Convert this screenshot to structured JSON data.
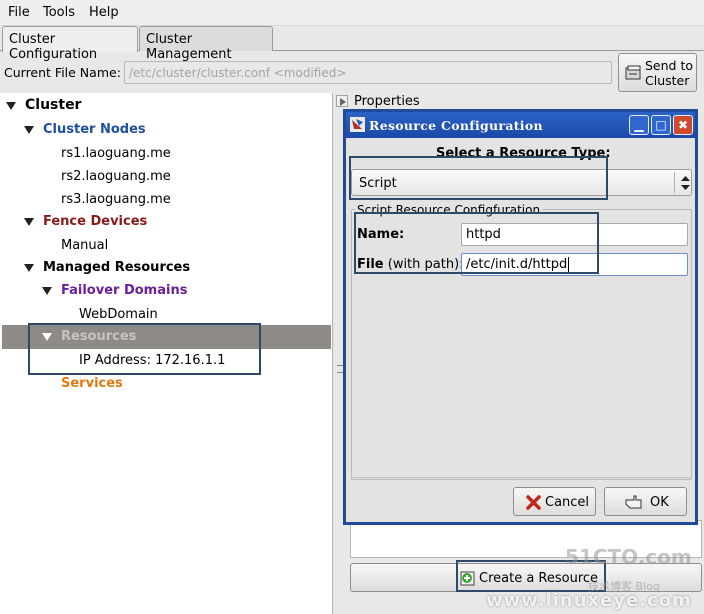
{
  "menubar": {
    "file": "File",
    "tools": "Tools",
    "help": "Help"
  },
  "tabs": {
    "config": "Cluster Configuration",
    "management": "Cluster Management"
  },
  "file_row": {
    "label": "Current File Name:",
    "value": "/etc/cluster/cluster.conf <modified>",
    "send_line1": "Send to",
    "send_line2": "Cluster"
  },
  "tree": {
    "cluster": "Cluster",
    "cluster_nodes": "Cluster Nodes",
    "nodes": [
      "rs1.laoguang.me",
      "rs2.laoguang.me",
      "rs3.laoguang.me"
    ],
    "fence_devices": "Fence Devices",
    "manual": "Manual",
    "managed_resources": "Managed Resources",
    "failover_domains": "Failover Domains",
    "webdomain": "WebDomain",
    "resources": "Resources",
    "ip_address": "IP Address:  172.16.1.1",
    "services": "Services"
  },
  "properties": {
    "label": "Properties",
    "create_button": "Create a Resource"
  },
  "dialog": {
    "title": "Resource Configuration",
    "select_label": "Select a Resource Type:",
    "type_value": "Script",
    "frame_label": "Script Resource Configfuration",
    "name_label": "Name:",
    "name_value": "httpd",
    "file_label_bold": "File",
    "file_label_rest": " (with path):",
    "file_value": "/etc/init.d/httpd",
    "cancel": "Cancel",
    "ok": "OK"
  },
  "watermark": {
    "line1": "51CTO.com",
    "line2": "技术博客  Blog",
    "line3": "www.linuxeye.com"
  },
  "colors": {
    "highlight_box": "#2f4a68",
    "dialog_border": "#1f4b9a",
    "selected_row": "#8e8a86"
  }
}
